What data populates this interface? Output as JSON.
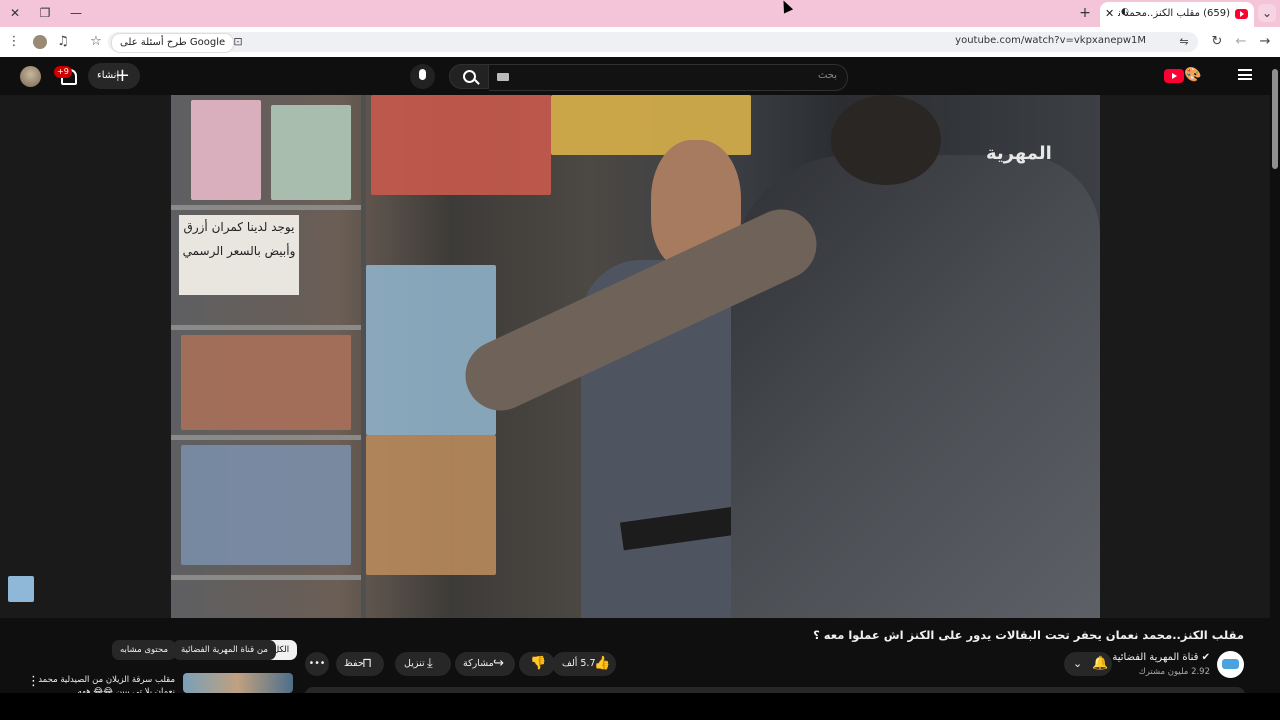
{
  "browser": {
    "tab_title": "(659) مقلب الكنز..محمد نعما",
    "url": "youtube.com/watch?v=vkpxanepw1M",
    "ask_google": "طرح أسئلة على Google"
  },
  "youtube": {
    "search_placeholder": "بحث",
    "create_label": "إنشاء",
    "notifications_badge": "+9",
    "video_watermark": "المهرية",
    "video_title": "مقلب الكنز..محمد نعمان يحفر تحت البقالات يدور على الكنز اش عملوا معه ؟",
    "channel_name": "قناة المهرية الفضائية",
    "subscribers": "2.92 مليون مشترك",
    "likes": "5.7 ألف",
    "share_label": "مشاركة",
    "download_label": "تنزيل",
    "save_label": "حفظ",
    "chips": [
      "الكل",
      "من قناة المهرية الفضائية",
      "محتوى مشابه"
    ],
    "recommended_title": "مقلب سرقة الزيلان من الصيدلية محمد نعمان يلا تي بيين 😂😂 ههه"
  }
}
